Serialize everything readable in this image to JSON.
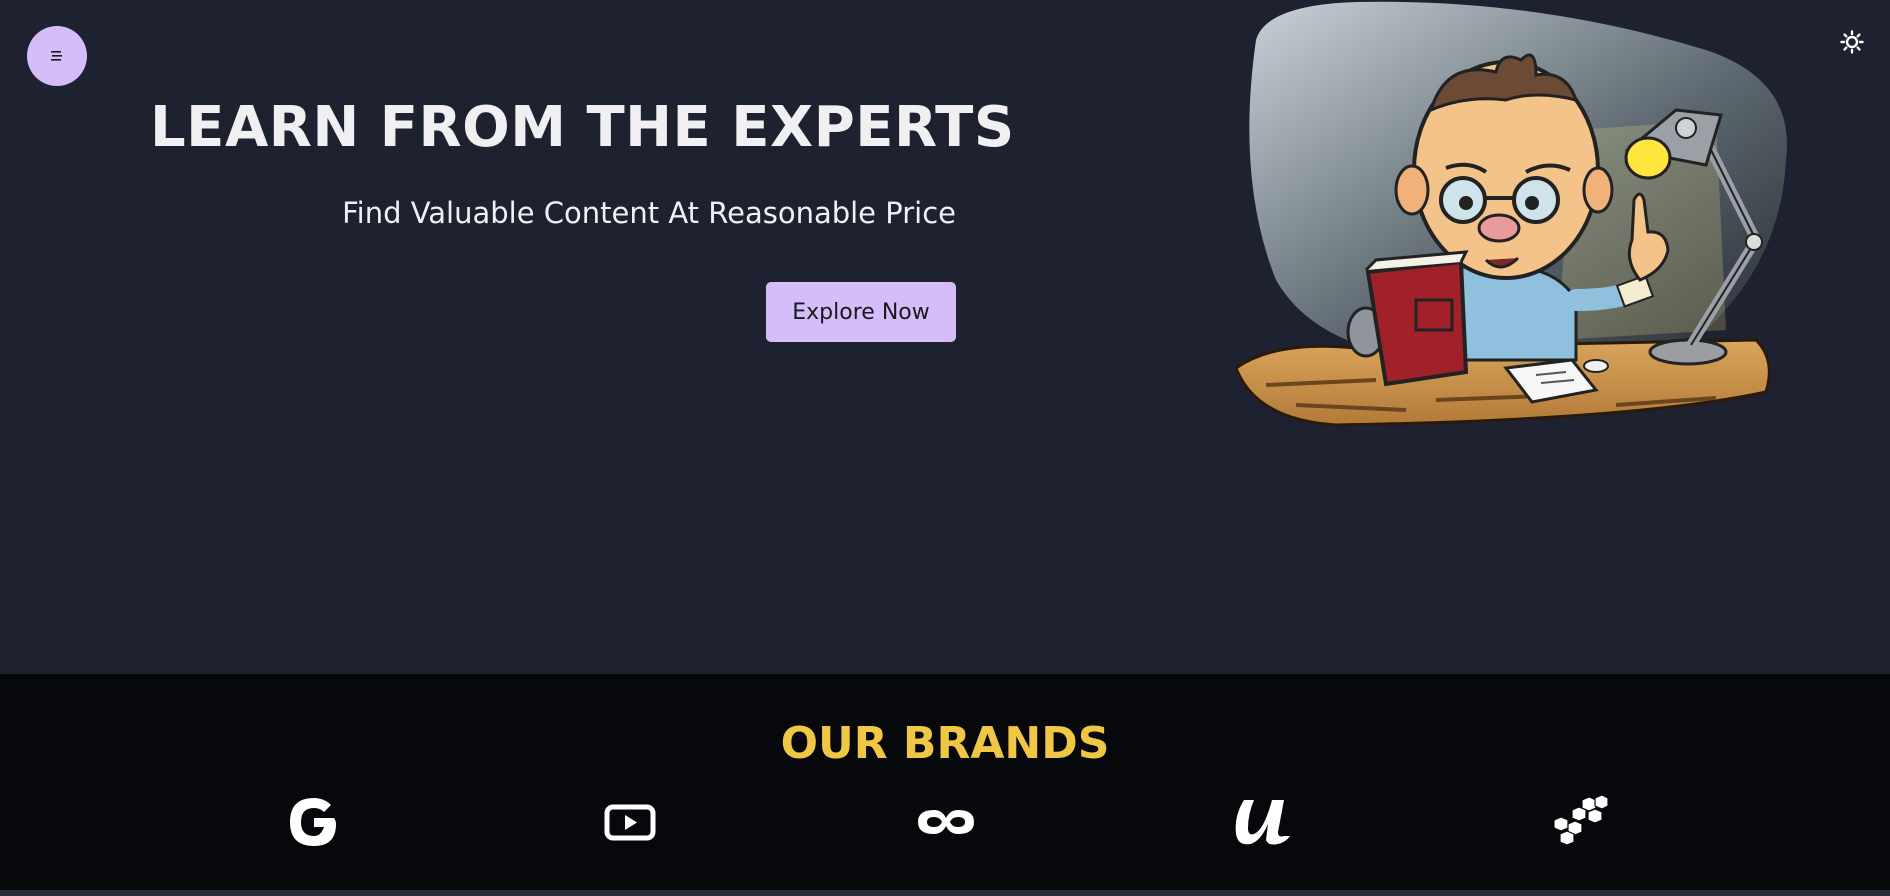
{
  "header": {
    "menu_icon": "hamburger-menu-icon",
    "theme_icon": "sun-icon"
  },
  "hero": {
    "title": "LEARN FROM THE EXPERTS",
    "subtitle": "Find Valuable Content At Reasonable Price",
    "cta_label": "Explore Now",
    "illustration": "cartoon-man-reading-book-at-desk-with-lamp"
  },
  "brands": {
    "title": "OUR BRANDS",
    "items": [
      {
        "name": "google-icon"
      },
      {
        "name": "youtube-icon"
      },
      {
        "name": "infinity-icon"
      },
      {
        "name": "udemy-icon"
      },
      {
        "name": "cubes-icon"
      }
    ]
  },
  "colors": {
    "background": "#1d2130",
    "accent": "#d4bdf9",
    "brands_title": "#efc745",
    "brands_background": "#07080c"
  }
}
